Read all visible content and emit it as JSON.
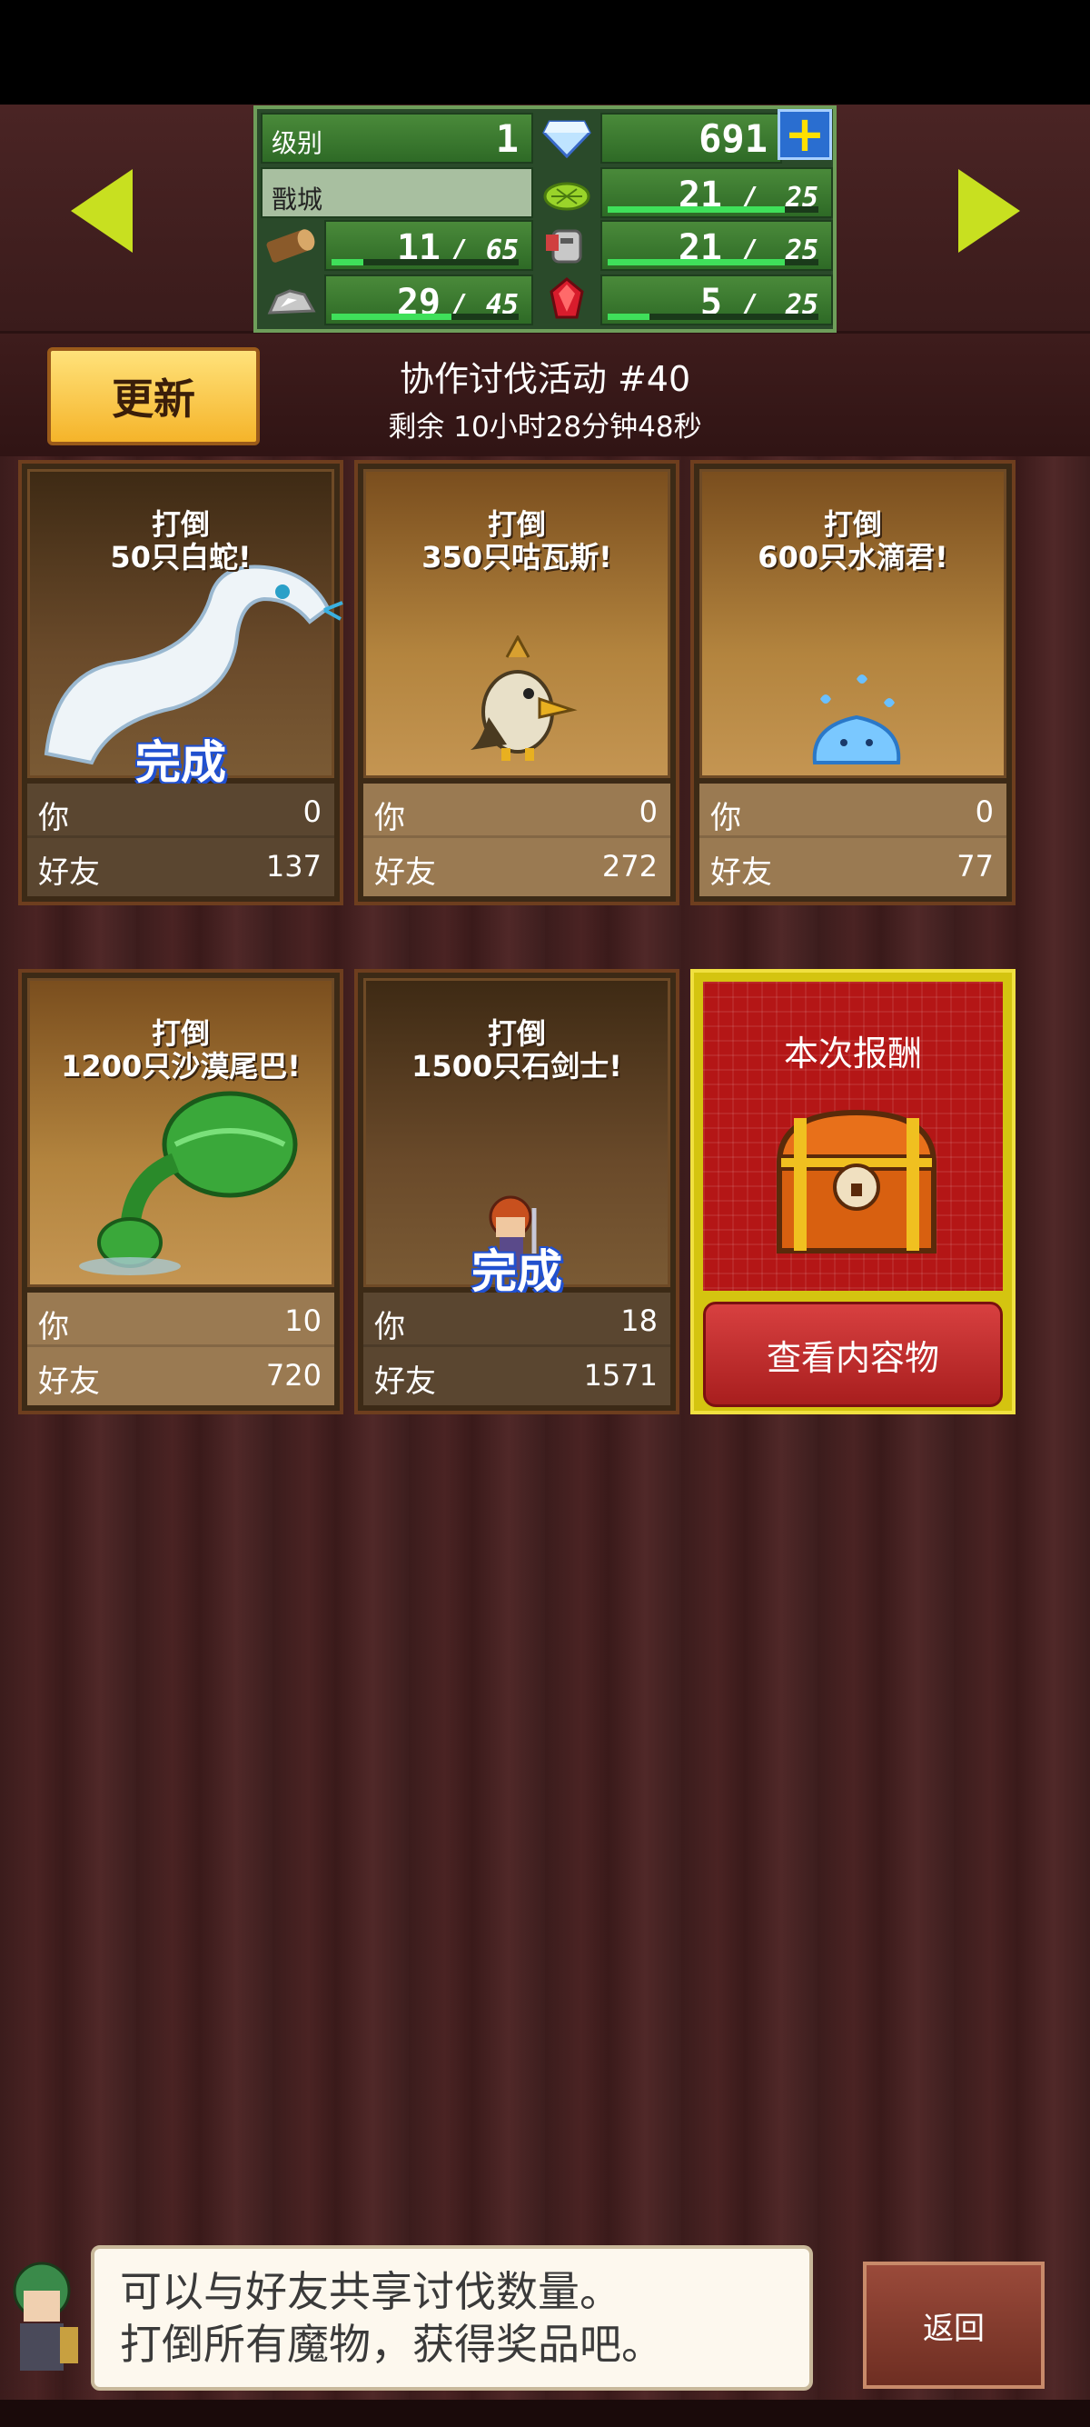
{
  "hud": {
    "level_label": "级别",
    "level_value": "1",
    "gems": "691",
    "town_name": "戬城",
    "resources": {
      "wood": {
        "current": "11",
        "max": "65",
        "fill": 0.17
      },
      "stone": {
        "current": "29",
        "max": "45",
        "fill": 0.64
      },
      "grass": {
        "current": "21",
        "max": "25",
        "fill": 0.84
      },
      "armor": {
        "current": "21",
        "max": "25",
        "fill": 0.84
      },
      "ruby": {
        "current": "5",
        "max": "25",
        "fill": 0.2
      }
    },
    "separator": "/"
  },
  "event": {
    "refresh_label": "更新",
    "title": "协作讨伐活动 #40",
    "time_remaining": "剩余 10小时28分钟48秒"
  },
  "cards": [
    {
      "target": "打倒\n50只白蛇!",
      "line1": "打倒",
      "line2": "50只白蛇!",
      "done": "完成",
      "you_label": "你",
      "you_value": "0",
      "friends_label": "好友",
      "friends_value": "137"
    },
    {
      "target": "",
      "line1": "打倒",
      "line2": "350只咕瓦斯!",
      "done": "",
      "you_label": "你",
      "you_value": "0",
      "friends_label": "好友",
      "friends_value": "272"
    },
    {
      "target": "",
      "line1": "打倒",
      "line2": "600只水滴君!",
      "done": "",
      "you_label": "你",
      "you_value": "0",
      "friends_label": "好友",
      "friends_value": "77"
    },
    {
      "target": "",
      "line1": "打倒",
      "line2": "1200只沙漠尾巴!",
      "done": "",
      "you_label": "你",
      "you_value": "10",
      "friends_label": "好友",
      "friends_value": "720"
    },
    {
      "target": "",
      "line1": "打倒",
      "line2": "1500只石剑士!",
      "done": "完成",
      "you_label": "你",
      "you_value": "18",
      "friends_label": "好友",
      "friends_value": "1571"
    }
  ],
  "reward": {
    "title": "本次报酬",
    "view_button": "查看内容物"
  },
  "message": {
    "line1": "可以与好友共享讨伐数量。",
    "line2": "打倒所有魔物，获得奖品吧。"
  },
  "back_button": "返回",
  "colors": {
    "hud_green": "#4a8a3a",
    "bar_green": "#3fe05a",
    "refresh_yellow": "#f5b42a",
    "done_blue": "#2050d0",
    "reward_red": "#b41616",
    "arrow_lime": "#c8e020"
  }
}
